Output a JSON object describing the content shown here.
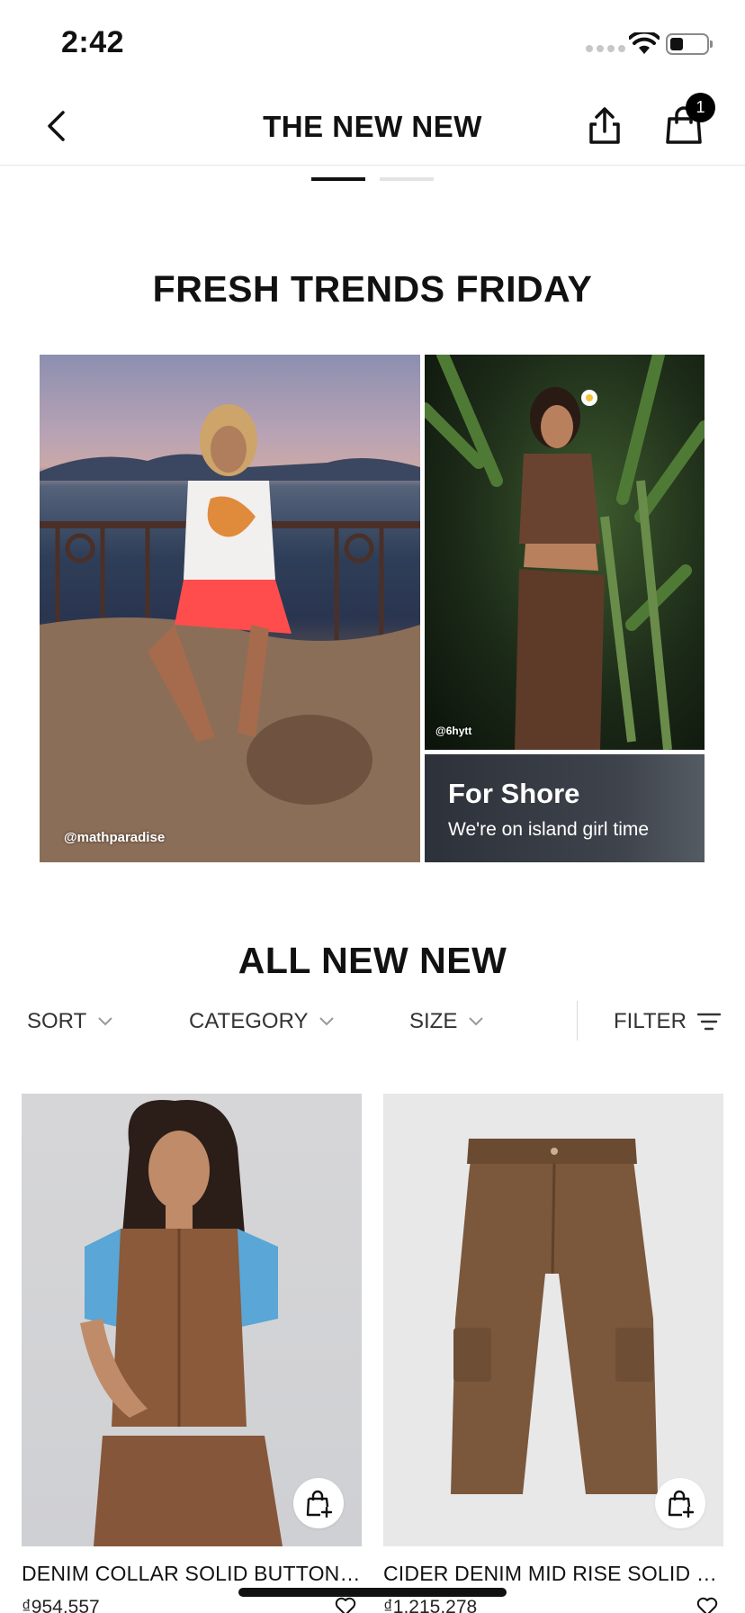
{
  "status_bar": {
    "time": "2:42"
  },
  "nav": {
    "title": "THE NEW NEW",
    "bag_count": "1"
  },
  "trends": {
    "title": "FRESH TRENDS FRIDAY",
    "left_credit": "@mathparadise",
    "right_credit": "@6hytt",
    "promo_title": "For Shore",
    "promo_subtitle": "We're on island girl time"
  },
  "all_new": {
    "title": "ALL NEW NEW",
    "filters": {
      "sort": "SORT",
      "category": "CATEGORY",
      "size": "SIZE",
      "filter": "FILTER"
    }
  },
  "products": [
    {
      "name": "DENIM COLLAR SOLID BUTTON UP VEST",
      "price": "₫954,557"
    },
    {
      "name": "CIDER DENIM MID RISE SOLID CARGO PANTS",
      "price": "₫1,215,278"
    }
  ],
  "colors": {
    "accent": "#111111",
    "divider": "#e6e6e6"
  }
}
